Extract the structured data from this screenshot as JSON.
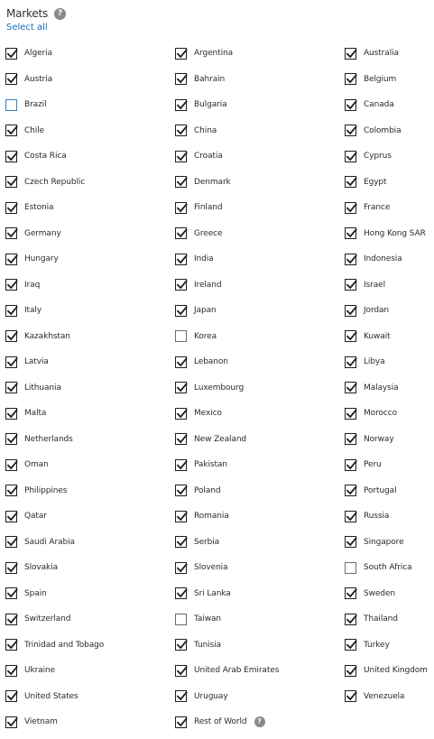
{
  "header": {
    "title": "Markets",
    "help_icon": "?",
    "select_all": "Select all"
  },
  "colors": {
    "link": "#106ebe",
    "checkbox_border": "#1e1e1e",
    "help_icon_bg": "#8a8a8a"
  },
  "markets": [
    {
      "label": "Algeria",
      "checked": true
    },
    {
      "label": "Argentina",
      "checked": true
    },
    {
      "label": "Australia",
      "checked": true
    },
    {
      "label": "Austria",
      "checked": true
    },
    {
      "label": "Bahrain",
      "checked": true
    },
    {
      "label": "Belgium",
      "checked": true
    },
    {
      "label": "Brazil",
      "checked": false
    },
    {
      "label": "Bulgaria",
      "checked": true
    },
    {
      "label": "Canada",
      "checked": true
    },
    {
      "label": "Chile",
      "checked": true
    },
    {
      "label": "China",
      "checked": true
    },
    {
      "label": "Colombia",
      "checked": true
    },
    {
      "label": "Costa Rica",
      "checked": true
    },
    {
      "label": "Croatia",
      "checked": true
    },
    {
      "label": "Cyprus",
      "checked": true
    },
    {
      "label": "Czech Republic",
      "checked": true
    },
    {
      "label": "Denmark",
      "checked": true
    },
    {
      "label": "Egypt",
      "checked": true
    },
    {
      "label": "Estonia",
      "checked": true
    },
    {
      "label": "Finland",
      "checked": true
    },
    {
      "label": "France",
      "checked": true
    },
    {
      "label": "Germany",
      "checked": true
    },
    {
      "label": "Greece",
      "checked": true
    },
    {
      "label": "Hong Kong SAR",
      "checked": true
    },
    {
      "label": "Hungary",
      "checked": true
    },
    {
      "label": "India",
      "checked": true
    },
    {
      "label": "Indonesia",
      "checked": true
    },
    {
      "label": "Iraq",
      "checked": true
    },
    {
      "label": "Ireland",
      "checked": true
    },
    {
      "label": "Israel",
      "checked": true
    },
    {
      "label": "Italy",
      "checked": true
    },
    {
      "label": "Japan",
      "checked": true
    },
    {
      "label": "Jordan",
      "checked": true
    },
    {
      "label": "Kazakhstan",
      "checked": true
    },
    {
      "label": "Korea",
      "checked": false
    },
    {
      "label": "Kuwait",
      "checked": true
    },
    {
      "label": "Latvia",
      "checked": true
    },
    {
      "label": "Lebanon",
      "checked": true
    },
    {
      "label": "Libya",
      "checked": true
    },
    {
      "label": "Lithuania",
      "checked": true
    },
    {
      "label": "Luxembourg",
      "checked": true
    },
    {
      "label": "Malaysia",
      "checked": true
    },
    {
      "label": "Malta",
      "checked": true
    },
    {
      "label": "Mexico",
      "checked": true
    },
    {
      "label": "Morocco",
      "checked": true
    },
    {
      "label": "Netherlands",
      "checked": true
    },
    {
      "label": "New Zealand",
      "checked": true
    },
    {
      "label": "Norway",
      "checked": true
    },
    {
      "label": "Oman",
      "checked": true
    },
    {
      "label": "Pakistan",
      "checked": true
    },
    {
      "label": "Peru",
      "checked": true
    },
    {
      "label": "Philippines",
      "checked": true
    },
    {
      "label": "Poland",
      "checked": true
    },
    {
      "label": "Portugal",
      "checked": true
    },
    {
      "label": "Qatar",
      "checked": true
    },
    {
      "label": "Romania",
      "checked": true
    },
    {
      "label": "Russia",
      "checked": true
    },
    {
      "label": "Saudi Arabia",
      "checked": true
    },
    {
      "label": "Serbia",
      "checked": true
    },
    {
      "label": "Singapore",
      "checked": true
    },
    {
      "label": "Slovakia",
      "checked": true
    },
    {
      "label": "Slovenia",
      "checked": true
    },
    {
      "label": "South Africa",
      "checked": false
    },
    {
      "label": "Spain",
      "checked": true
    },
    {
      "label": "Sri Lanka",
      "checked": true
    },
    {
      "label": "Sweden",
      "checked": true
    },
    {
      "label": "Switzerland",
      "checked": true
    },
    {
      "label": "Taiwan",
      "checked": false
    },
    {
      "label": "Thailand",
      "checked": true
    },
    {
      "label": "Trinidad and Tobago",
      "checked": true
    },
    {
      "label": "Tunisia",
      "checked": true
    },
    {
      "label": "Turkey",
      "checked": true
    },
    {
      "label": "Ukraine",
      "checked": true
    },
    {
      "label": "United Arab Emirates",
      "checked": true
    },
    {
      "label": "United Kingdom",
      "checked": true
    },
    {
      "label": "United States",
      "checked": true
    },
    {
      "label": "Uruguay",
      "checked": true
    },
    {
      "label": "Venezuela",
      "checked": true
    },
    {
      "label": "Vietnam",
      "checked": true
    },
    {
      "label": "Rest of World",
      "checked": true,
      "help": "?"
    }
  ]
}
